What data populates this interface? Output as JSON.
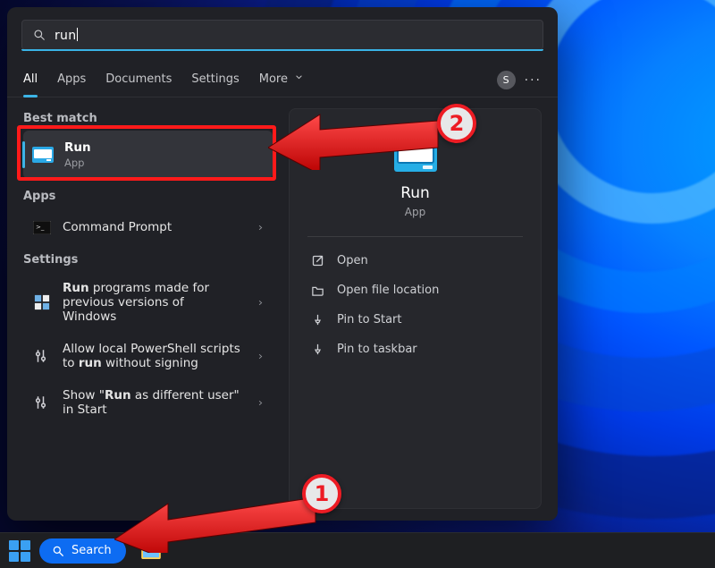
{
  "search": {
    "query": "run"
  },
  "tabs": {
    "items": [
      "All",
      "Apps",
      "Documents",
      "Settings",
      "More"
    ],
    "active": 0
  },
  "user": {
    "initial": "S"
  },
  "left": {
    "best_match_label": "Best match",
    "top_result": {
      "title": "Run",
      "subtitle": "App"
    },
    "apps_label": "Apps",
    "app_results": [
      {
        "title": "Command Prompt"
      }
    ],
    "settings_label": "Settings",
    "settings_results": [
      {
        "title_pre": "Run",
        "title_post": " programs made for previous versions of Windows"
      },
      {
        "title_pre": "Allow local PowerShell scripts to ",
        "title_mid": "run",
        "title_post": " without signing"
      },
      {
        "title_pre": "Show \"",
        "title_mid": "Run",
        "title_post": " as different user\" in Start"
      }
    ]
  },
  "preview": {
    "title": "Run",
    "subtitle": "App",
    "actions": {
      "open": "Open",
      "open_loc": "Open file location",
      "pin_start": "Pin to Start",
      "pin_taskbar": "Pin to taskbar"
    }
  },
  "taskbar": {
    "search_label": "Search"
  },
  "annotations": {
    "n1": "1",
    "n2": "2"
  }
}
